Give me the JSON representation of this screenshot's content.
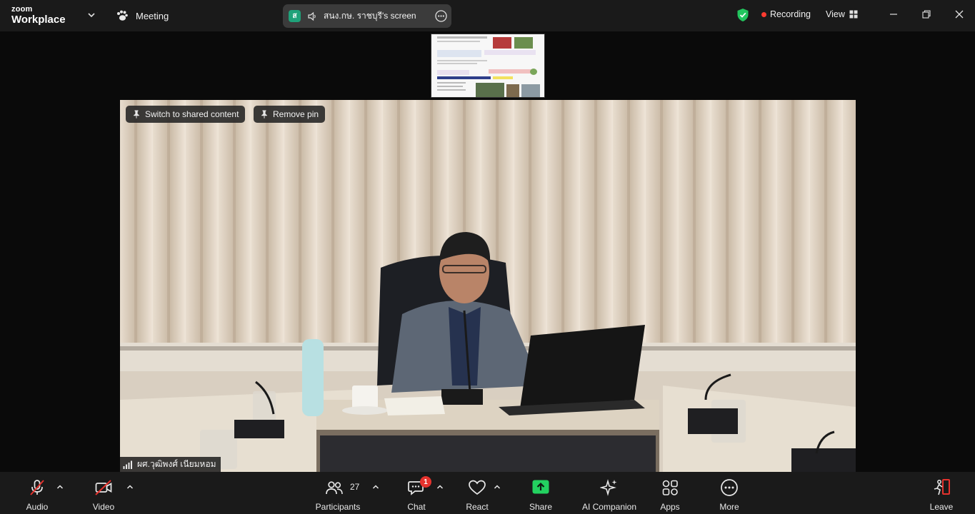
{
  "app": {
    "logo_small": "zoom",
    "logo_big": "Workplace",
    "meeting_label": "Meeting"
  },
  "share": {
    "avatar_letter": "ส",
    "label": "สนง.กษ. ราชบุรี's screen"
  },
  "status": {
    "recording_label": "Recording",
    "view_label": "View",
    "recording_color": "#ff3b30",
    "shield_color": "#22c55e"
  },
  "video": {
    "switch_label": "Switch to shared content",
    "remove_pin_label": "Remove pin",
    "participant_name": "ผศ.วุฒิพงศ์ เนียมหอม"
  },
  "toolbar": {
    "audio": "Audio",
    "video": "Video",
    "participants": "Participants",
    "participants_count": "27",
    "chat": "Chat",
    "chat_badge": "1",
    "react": "React",
    "share": "Share",
    "share_color": "#23d160",
    "ai": "AI Companion",
    "apps": "Apps",
    "more": "More",
    "leave": "Leave",
    "leave_color": "#e5322d"
  }
}
